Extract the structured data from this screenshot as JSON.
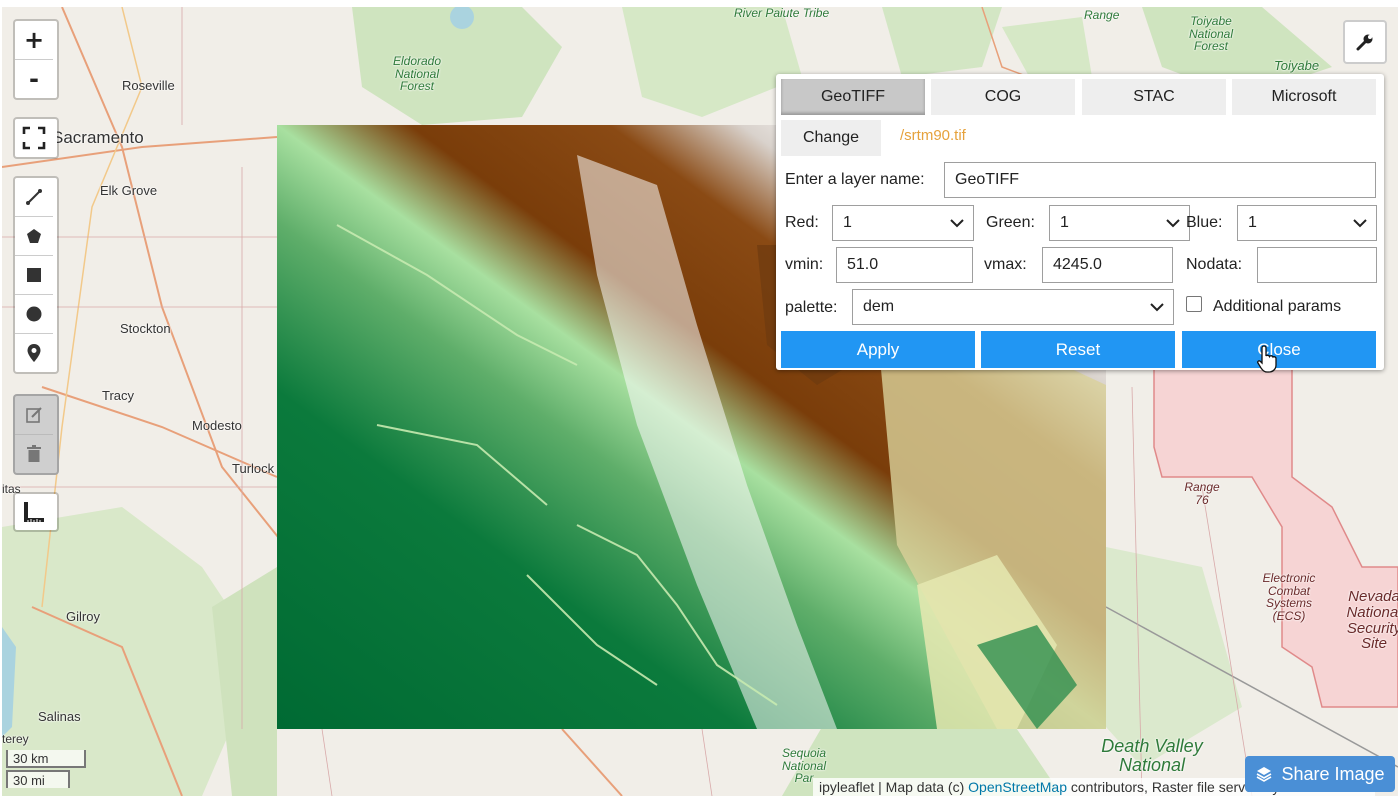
{
  "map": {
    "labels": {
      "river_paiute": "River Paiute Tribe",
      "range_top": "Range",
      "toiyabe_nf": "Toiyabe National Forest",
      "toiyabe": "Toiyabe",
      "eldorado": "Eldorado National Forest",
      "roseville": "Roseville",
      "sacramento": "Sacramento",
      "elk_grove": "Elk Grove",
      "stockton": "Stockton",
      "tracy": "Tracy",
      "modesto": "Modesto",
      "turlock": "Turlock",
      "gilroy": "Gilroy",
      "salinas": "Salinas",
      "terey": "terey",
      "itas": "itas",
      "range76": "Range 76",
      "ecs": "Electronic Combat Systems (ECS)",
      "nevada": "Nevada National Security Site",
      "death_valley": "Death Valley National",
      "sequoia": "Sequoia National Par"
    },
    "raster_layer": "GeoTIFF",
    "palette_colors": [
      "#006a33",
      "#a8e0a0",
      "#e5e8b0",
      "#7a3d0a",
      "#ffffff"
    ]
  },
  "controls": {
    "zoom_in": "+",
    "zoom_out": "-"
  },
  "panel": {
    "tabs": [
      "GeoTIFF",
      "COG",
      "STAC",
      "Microsoft"
    ],
    "active_tab": "GeoTIFF",
    "change_label": "Change",
    "file_path": "/srtm90.tif",
    "layer_name_label": "Enter a layer name:",
    "layer_name_value": "GeoTIFF",
    "red_label": "Red:",
    "red_value": "1",
    "green_label": "Green:",
    "green_value": "1",
    "blue_label": "Blue:",
    "blue_value": "1",
    "vmin_label": "vmin:",
    "vmin_value": "51.0",
    "vmax_label": "vmax:",
    "vmax_value": "4245.0",
    "nodata_label": "Nodata:",
    "nodata_value": "",
    "palette_label": "palette:",
    "palette_value": "dem",
    "additional_params_label": "Additional params",
    "additional_params_checked": false,
    "apply_label": "Apply",
    "reset_label": "Reset",
    "close_label": "Close",
    "accent_color": "#2196f3",
    "path_color": "#e6a23c"
  },
  "scale": {
    "metric": "30 km",
    "imperial": "30 mi"
  },
  "share_label": "Share Image",
  "attribution": {
    "prefix": "ipyleaflet | Map data (c)",
    "osm": "OpenStreetMap",
    "suffix": "contributors, Raster file served by localtileserver"
  }
}
